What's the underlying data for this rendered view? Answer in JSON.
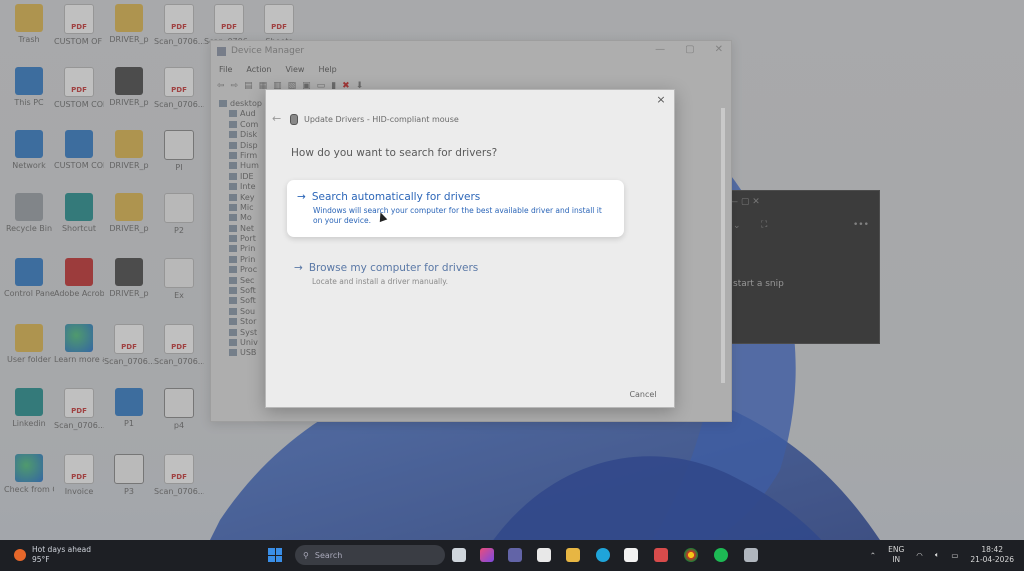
{
  "desktop": {
    "icons": [
      {
        "label": "Trash",
        "kind": "folder-user"
      },
      {
        "label": "CUSTOM OF THE...",
        "kind": "pdf"
      },
      {
        "label": "DRIVER_p",
        "kind": "folder"
      },
      {
        "label": "Scan_0706...",
        "kind": "pdf"
      },
      {
        "label": "Scan_0706...",
        "kind": "pdf"
      },
      {
        "label": "Sheets",
        "kind": "pdf"
      },
      {
        "label": "This PC",
        "kind": "monitor"
      },
      {
        "label": "CUSTOM CONFERE...",
        "kind": "pdf"
      },
      {
        "label": "DRIVER_p",
        "kind": "folder-dark"
      },
      {
        "label": "Scan_0706...",
        "kind": "pdf"
      },
      {
        "label": "Network",
        "kind": "network"
      },
      {
        "label": "CUSTOM CONFERE...",
        "kind": "word"
      },
      {
        "label": "DRIVER_p",
        "kind": "folder"
      },
      {
        "label": "PI",
        "kind": "film"
      },
      {
        "label": "Recycle Bin",
        "kind": "recycle"
      },
      {
        "label": "Shortcut",
        "kind": "shortcut"
      },
      {
        "label": "DRIVER_p",
        "kind": "folder"
      },
      {
        "label": "P2",
        "kind": "file"
      },
      {
        "label": "Control Panel",
        "kind": "control"
      },
      {
        "label": "Adobe Acrobat",
        "kind": "acrobat"
      },
      {
        "label": "DRIVER_p",
        "kind": "folder-dark"
      },
      {
        "label": "Ex",
        "kind": "file"
      },
      {
        "label": "User folder",
        "kind": "folder"
      },
      {
        "label": "Learn more about this pict...",
        "kind": "edge"
      },
      {
        "label": "Scan_0706...",
        "kind": "pdf"
      },
      {
        "label": "Scan_0706...",
        "kind": "pdf"
      },
      {
        "label": "Linkedin",
        "kind": "teal"
      },
      {
        "label": "Scan_0706...",
        "kind": "pdf"
      },
      {
        "label": "P1",
        "kind": "image"
      },
      {
        "label": "p4",
        "kind": "film"
      },
      {
        "label": "Check from Google",
        "kind": "edge"
      },
      {
        "label": "Invoice",
        "kind": "pdf"
      },
      {
        "label": "P3",
        "kind": "film"
      },
      {
        "label": "Scan_0706...",
        "kind": "pdf"
      }
    ]
  },
  "device_manager": {
    "title": "Device Manager",
    "menu": [
      "File",
      "Action",
      "View",
      "Help"
    ],
    "tree": [
      "desktop",
      "Aud",
      "Com",
      "Disk",
      "Disp",
      "Firm",
      "Hum",
      "IDE",
      "Inte",
      "Key",
      "Mic",
      "Mo",
      "Net",
      "Port",
      "Prin",
      "Prin",
      "Proc",
      "Sec",
      "Soft",
      "Soft",
      "Sou",
      "Stor",
      "Syst",
      "Univ",
      "USB"
    ]
  },
  "snip": {
    "text": "start a snip"
  },
  "dialog": {
    "header": "Update Drivers - HID-compliant mouse",
    "question": "How do you want to search for drivers?",
    "option1": {
      "title": "Search automatically for drivers",
      "description": "Windows will search your computer for the best available driver and install it on your device."
    },
    "option2": {
      "title": "Browse my computer for drivers",
      "description": "Locate and install a driver manually."
    },
    "cancel": "Cancel",
    "close": "×"
  },
  "taskbar": {
    "weather_title": "Hot days ahead",
    "weather_temp": "95°F",
    "search_placeholder": "Search",
    "lang1": "ENG",
    "lang2": "IN",
    "time": "18:42",
    "date": "21-04-2026"
  }
}
